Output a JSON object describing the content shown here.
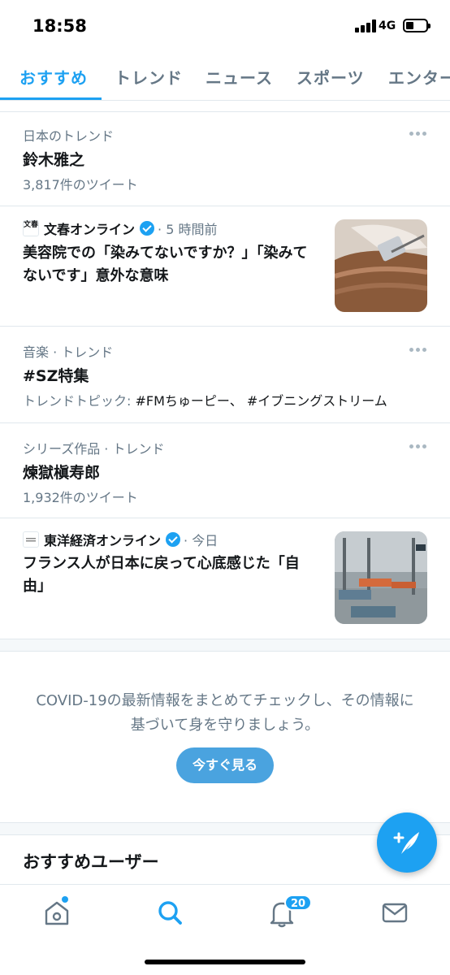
{
  "status": {
    "time": "18:58",
    "network": "4G"
  },
  "tabs": [
    {
      "label": "おすすめ"
    },
    {
      "label": "トレンド"
    },
    {
      "label": "ニュース"
    },
    {
      "label": "スポーツ"
    },
    {
      "label": "エンター"
    }
  ],
  "feed": {
    "trend1": {
      "category": "日本のトレンド",
      "title": "鈴木雅之",
      "count": "3,817件のツイート"
    },
    "news1": {
      "source": "文春オンライン",
      "logo_text": "文春",
      "time": "· 5 時間前",
      "headline": "美容院での「染みてないですか？」「染みてないです」意外な意味"
    },
    "trend2": {
      "category": "音楽 · トレンド",
      "title": "#SZ特集",
      "topic_label": "トレンドトピック: ",
      "topics": "#FMちゅーピー、 #イブニングストリーム"
    },
    "trend3": {
      "category": "シリーズ作品 · トレンド",
      "title": "煉獄槇寿郎",
      "count": "1,932件のツイート"
    },
    "news2": {
      "source": "東洋経済オンライン",
      "time": "· 今日",
      "headline": "フランス人が日本に戻って心底感じた「自由」"
    }
  },
  "covid": {
    "text": "COVID-19の最新情報をまとめてチェックし、その情報に基づいて身を守りましょう。",
    "button": "今すぐ見る"
  },
  "recommended": {
    "title": "おすすめユーザー"
  },
  "nav": {
    "notifications_badge": "20"
  },
  "colors": {
    "accent": "#1da1f2",
    "secondary_text": "#657786",
    "primary_text": "#14171a"
  },
  "icons": [
    "home-icon",
    "search-icon",
    "bell-icon",
    "mail-icon",
    "compose-tweet-icon",
    "verified-icon",
    "more-icon"
  ]
}
